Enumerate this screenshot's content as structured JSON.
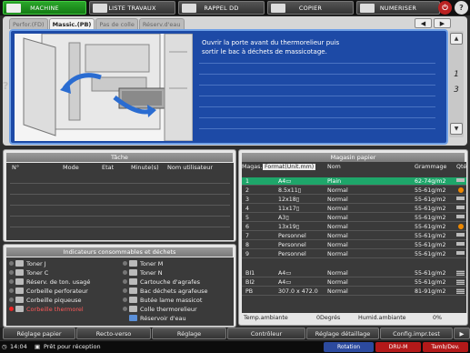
{
  "modes": [
    {
      "label": "MACHINE",
      "active": true
    },
    {
      "label": "LISTE TRAVAUX",
      "active": false
    },
    {
      "label": "RAPPEL DD",
      "active": false
    },
    {
      "label": "COPIER",
      "active": false
    },
    {
      "label": "NUMERISER",
      "active": false
    }
  ],
  "top_icons": {
    "power": "⏻",
    "help": "?"
  },
  "tabs": [
    "Perfor.(FD)",
    "Massic.(PB)",
    "Pas de colle",
    "Réserv.d'eau"
  ],
  "nav": {
    "prev": "◀",
    "next": "▶"
  },
  "message": {
    "line1": "Ouvrir la porte avant du thermorelieur puis",
    "line2": "sortir le bac à déchets de massicotage."
  },
  "pager": {
    "current": "1",
    "total": "3",
    "up": "▲",
    "down": "▼"
  },
  "help_mark": "?",
  "job": {
    "title": "Tâche",
    "columns": {
      "num": "N°",
      "mode": "Mode",
      "state": "Etat",
      "minutes": "Minute(s)",
      "user": "Nom utilisateur"
    }
  },
  "consumables": {
    "title": "Indicateurs consommables et déchets",
    "left": [
      "Toner J",
      "Toner C",
      "Réserv. de ton. usagé",
      "Corbeille perforateur",
      "Corbeille piqueuse",
      "Corbeille thermorel"
    ],
    "right": [
      "Toner M",
      "Toner N",
      "Cartouche d'agrafes",
      "Bac déchets agrafeuse",
      "Butée lame massicot",
      "Colle thermorelieur",
      "Réservoir d'eau"
    ]
  },
  "paper": {
    "title": "Magasin papier",
    "columns": {
      "tray": "Magas.",
      "format": "Format(Unit.mm)",
      "name": "Nom",
      "weight": "Grammage",
      "qty": "Qté"
    },
    "rows": [
      {
        "tray": "1",
        "format": "A4▭",
        "name": "Plain",
        "weight": "62-74g/m2",
        "ind": "bar"
      },
      {
        "tray": "2",
        "format": "8.5x11▯",
        "name": "Normal",
        "weight": "55-61g/m2",
        "ind": "warn"
      },
      {
        "tray": "3",
        "format": "12x18▯",
        "name": "Normal",
        "weight": "55-61g/m2",
        "ind": "bar"
      },
      {
        "tray": "4",
        "format": "11x17▯",
        "name": "Normal",
        "weight": "55-61g/m2",
        "ind": "bar"
      },
      {
        "tray": "5",
        "format": "A3▯",
        "name": "Normal",
        "weight": "55-61g/m2",
        "ind": "bar"
      },
      {
        "tray": "6",
        "format": "13x19▯",
        "name": "Normal",
        "weight": "55-61g/m2",
        "ind": "warn"
      },
      {
        "tray": "7",
        "format": "Personnel",
        "name": "Normal",
        "weight": "55-61g/m2",
        "ind": "bar"
      },
      {
        "tray": "8",
        "format": "Personnel",
        "name": "Normal",
        "weight": "55-61g/m2",
        "ind": "bar"
      },
      {
        "tray": "9",
        "format": "Personnel",
        "name": "Normal",
        "weight": "55-61g/m2",
        "ind": "bar"
      }
    ],
    "rows2": [
      {
        "tray": "BI1",
        "format": "A4▭",
        "name": "Normal",
        "weight": "55-61g/m2",
        "ind": "stripe"
      },
      {
        "tray": "BI2",
        "format": "A4▭",
        "name": "Normal",
        "weight": "55-61g/m2",
        "ind": "stripe"
      },
      {
        "tray": "PB",
        "format": "307.0 x 472.0",
        "name": "Normal",
        "weight": "81-91g/m2",
        "ind": "stripe"
      }
    ],
    "temp_label": "Temp.ambiante",
    "temp_value": "0Degrés",
    "hum_label": "Humid.ambiante",
    "hum_value": "0%"
  },
  "bottom_tabs": [
    "Réglage papier",
    "Recto-verso",
    "Réglage",
    "Contrôleur",
    "Réglage détaillage",
    "Config.impr.test"
  ],
  "bottom_arrow": "▶",
  "status": {
    "time": "14:04",
    "state": "Prêt pour réception",
    "rotation": "Rotation",
    "dru": "DRU-M",
    "tamb": "Tamb/Dev."
  }
}
